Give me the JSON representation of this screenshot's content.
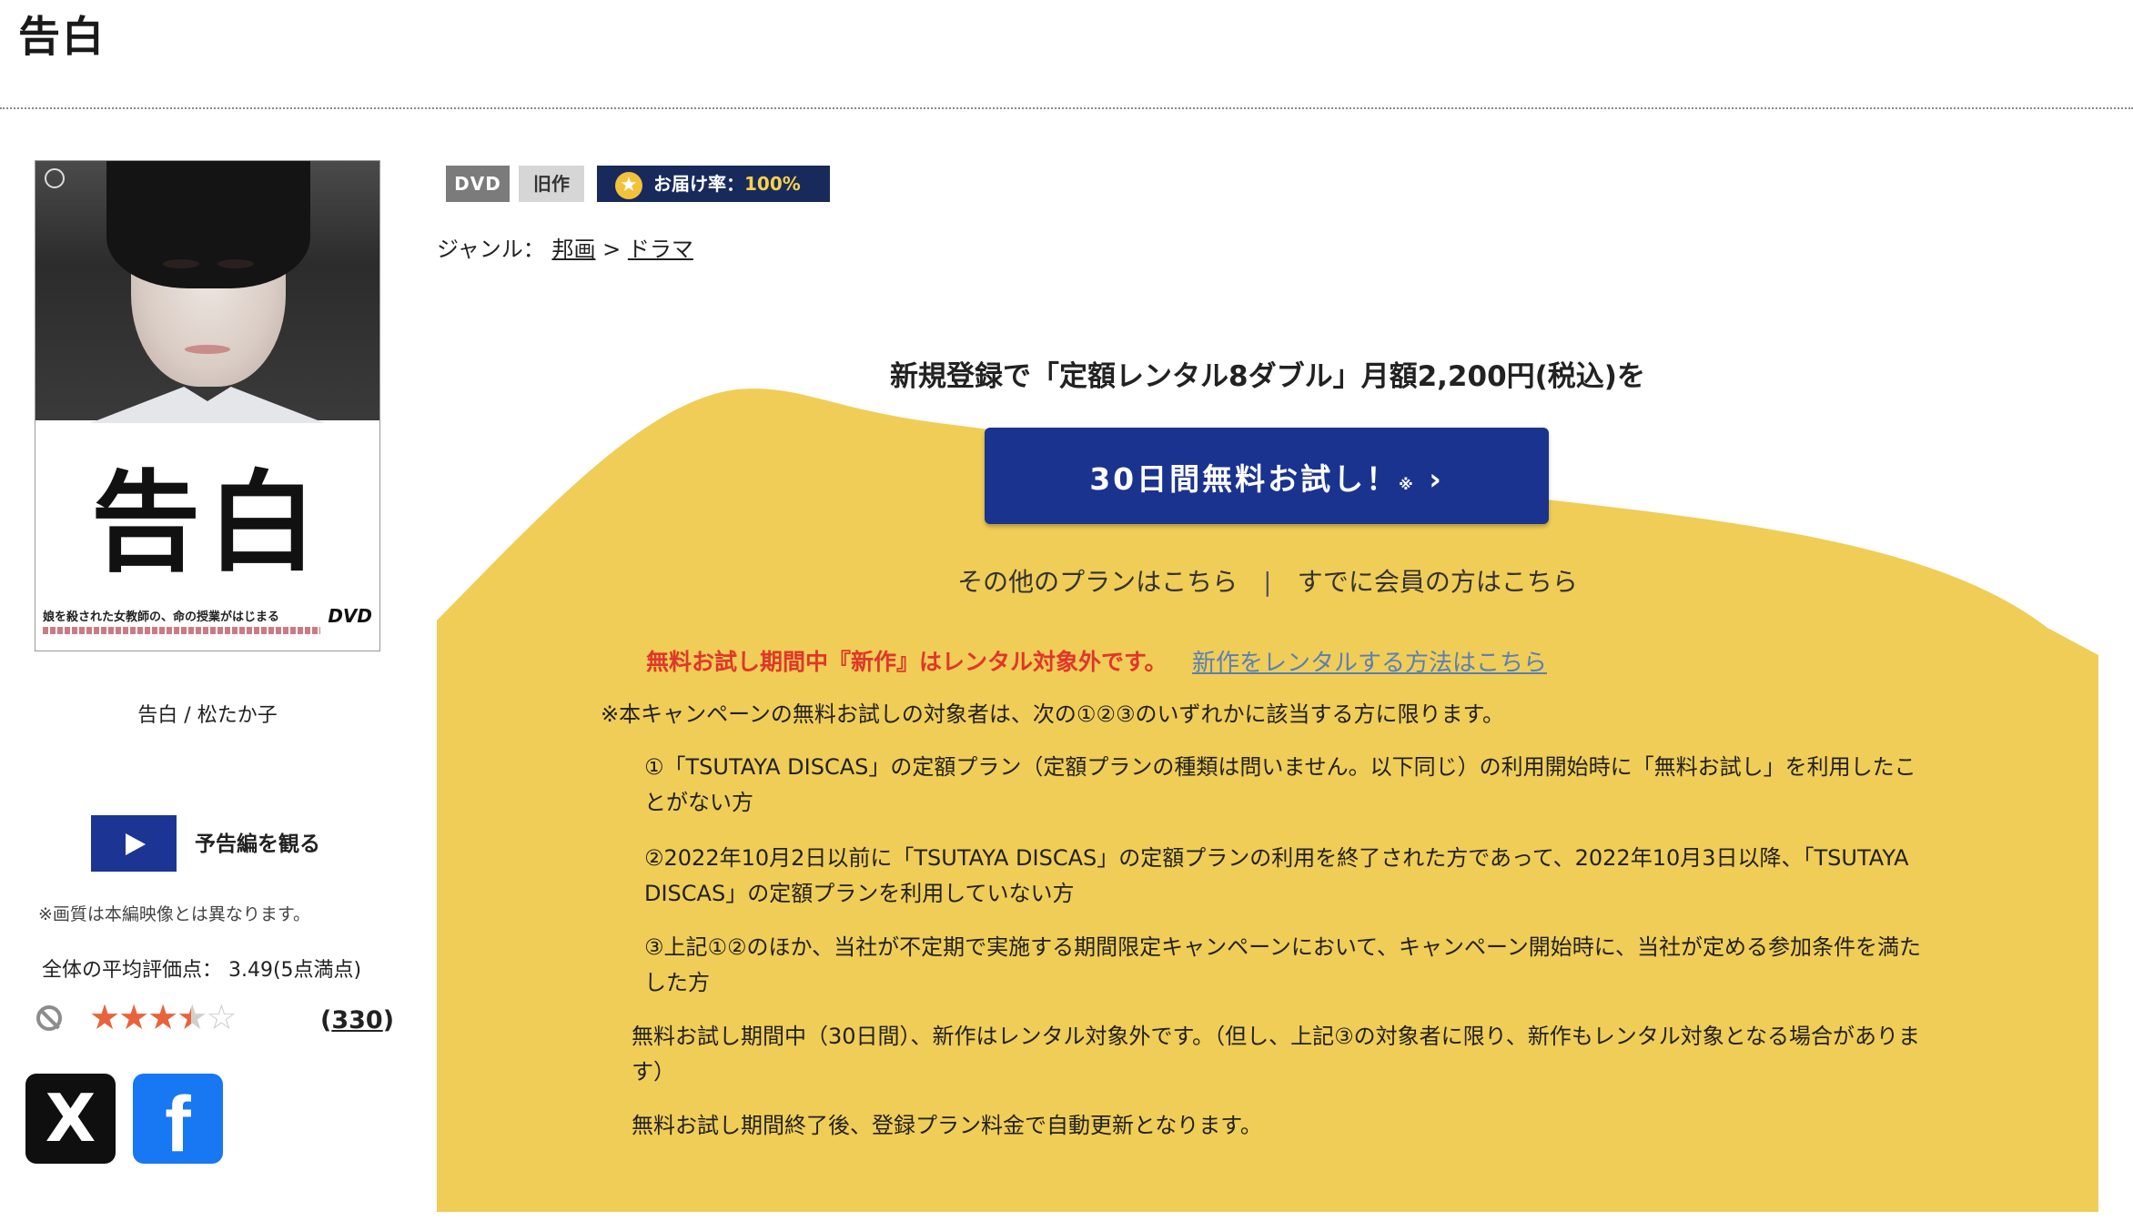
{
  "page_title": "告白",
  "cover": {
    "title": "告白",
    "caption": "娘を殺された女教師の、命の授業がはじまる",
    "dvd_logo": "DVD"
  },
  "product_name": "告白 / 松たか子",
  "trailer": {
    "label": "予告編を観る"
  },
  "quality_note": "※画質は本編映像とは異なります。",
  "rating": {
    "label": "全体の平均評価点： 3.49(5点満点)",
    "value": 3.49,
    "max": 5,
    "review_count": "330"
  },
  "social": {
    "x_label": "X",
    "facebook_label": "f"
  },
  "badges": {
    "dvd": "DVD",
    "old": "旧作",
    "rate_label": "お届け率：",
    "rate_value": "100%"
  },
  "genre": {
    "label": "ジャンル：",
    "items": [
      "邦画",
      "ドラマ"
    ],
    "separator": ">"
  },
  "campaign": {
    "headline": "新規登録で「定額レンタル8ダブル」月額2,200円(税込)を",
    "cta_label": "30日間無料お試し！",
    "cta_mark": "※",
    "other_plans": "その他のプランはこちら",
    "members": "すでに会員の方はこちら",
    "notice_red": "無料お試し期間中『新作』はレンタル対象外です。",
    "notice_link": "新作をレンタルする方法はこちら",
    "target_text": "※本キャンペーンの無料お試しの対象者は、次の①②③のいずれかに該当する方に限ります。",
    "conditions": [
      "①「TSUTAYA DISCAS」の定額プラン（定額プランの種類は問いません。以下同じ）の利用開始時に「無料お試し」を利用したことがない方",
      "②2022年10月2日以前に「TSUTAYA DISCAS」の定額プランの利用を終了された方であって、2022年10月3日以降、「TSUTAYA DISCAS」の定額プランを利用していない方",
      "③上記①②のほか、当社が不定期で実施する期間限定キャンペーンにおいて、キャンペーン開始時に、当社が定める参加条件を満たした方"
    ],
    "note1": "無料お試し期間中（30日間）、新作はレンタル対象外です。（但し、上記③の対象者に限り、新作もレンタル対象となる場合があります）",
    "note2": "無料お試し期間終了後、登録プラン料金で自動更新となります。"
  },
  "colors": {
    "panel_yellow": "#f0cd57",
    "cta_blue": "#1a338f",
    "notice_red": "#e0372a",
    "rate_badge": "#182a5b"
  }
}
